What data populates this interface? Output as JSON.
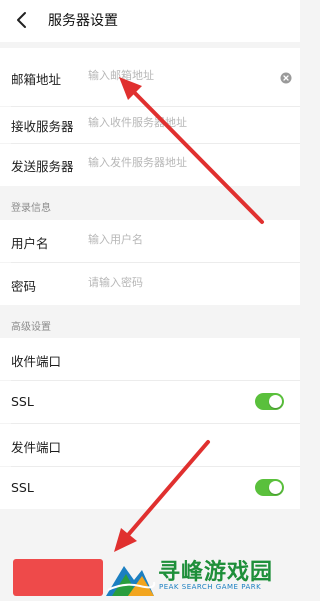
{
  "header": {
    "title": "服务器设置"
  },
  "form": {
    "email_label": "邮箱地址",
    "email_placeholder": "输入邮箱地址",
    "incoming_label": "接收服务器",
    "incoming_placeholder": "输入收件服务器地址",
    "outgoing_label": "发送服务器",
    "outgoing_placeholder": "输入发件服务器地址"
  },
  "login_section": {
    "title": "登录信息",
    "username_label": "用户名",
    "username_placeholder": "输入用户名",
    "password_label": "密码",
    "password_placeholder": "请输入密码"
  },
  "advanced_section": {
    "title": "高级设置",
    "incoming_port_label": "收件端口",
    "incoming_ssl_label": "SSL",
    "incoming_ssl_enabled": true,
    "outgoing_port_label": "发件端口",
    "outgoing_ssl_label": "SSL",
    "outgoing_ssl_enabled": true
  },
  "watermark": {
    "title": "寻峰游戏园",
    "subtitle": "PEAK SEARCH GAME PARK"
  },
  "colors": {
    "toggle_on": "#5ac03c",
    "bottom_button": "#ee4a4a",
    "annotation_arrow": "#e0302f",
    "watermark_green": "#1e8f3a",
    "watermark_blue": "#1b7fc1"
  }
}
